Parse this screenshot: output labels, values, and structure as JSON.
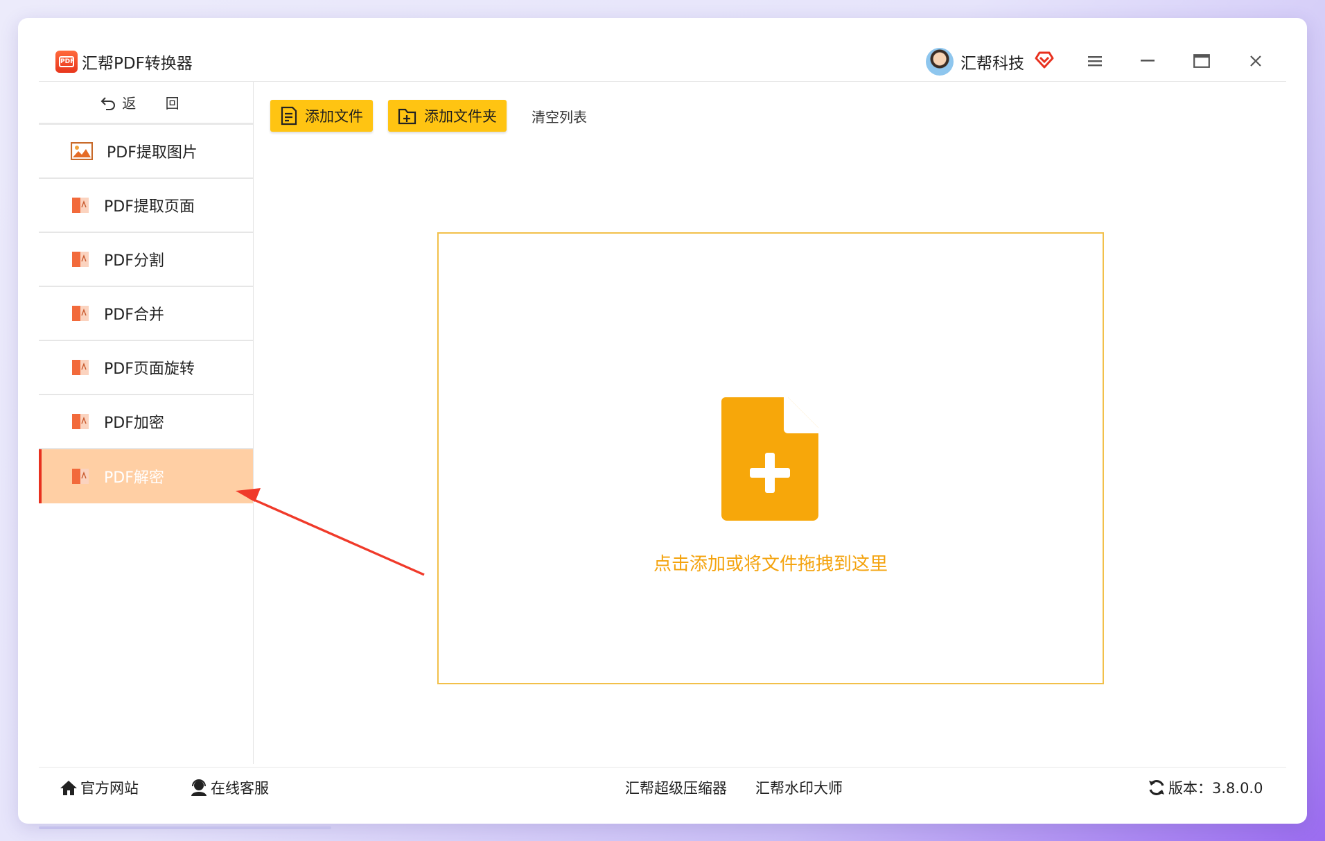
{
  "titlebar": {
    "app_title": "汇帮PDF转换器",
    "logo_text": "PDF",
    "user_name": "汇帮科技",
    "icons": [
      "pdf-logo-icon",
      "avatar",
      "vip-heart-icon",
      "menu-icon",
      "minimize-icon",
      "maximize-icon",
      "close-icon"
    ]
  },
  "sidebar": {
    "back_label": "返 回",
    "items": [
      {
        "label": "PDF提取图片",
        "icon": "image-icon"
      },
      {
        "label": "PDF提取页面",
        "icon": "pdf-file-icon"
      },
      {
        "label": "PDF分割",
        "icon": "pdf-file-icon"
      },
      {
        "label": "PDF合并",
        "icon": "pdf-file-icon"
      },
      {
        "label": "PDF页面旋转",
        "icon": "pdf-file-icon"
      },
      {
        "label": "PDF加密",
        "icon": "pdf-file-icon"
      },
      {
        "label": "PDF解密",
        "icon": "pdf-file-icon",
        "active": true
      }
    ]
  },
  "toolbar": {
    "add_file": "添加文件",
    "add_folder": "添加文件夹",
    "clear_list": "清空列表"
  },
  "dropzone": {
    "hint": "点击添加或将文件拖拽到这里",
    "icon": "add-file-icon"
  },
  "footer": {
    "official_site": "官方网站",
    "online_service": "在线客服",
    "compressor": "汇帮超级压缩器",
    "watermark": "汇帮水印大师",
    "version": "版本：3.8.0.0"
  },
  "colors": {
    "accent_yellow": "#ffc412",
    "active_item_bg": "#ffcfa4",
    "active_indicator": "#e8311f",
    "dropzone_border": "#f2c04a",
    "hint_text": "#f4a30e",
    "annotation_arrow": "#f03a2a"
  }
}
